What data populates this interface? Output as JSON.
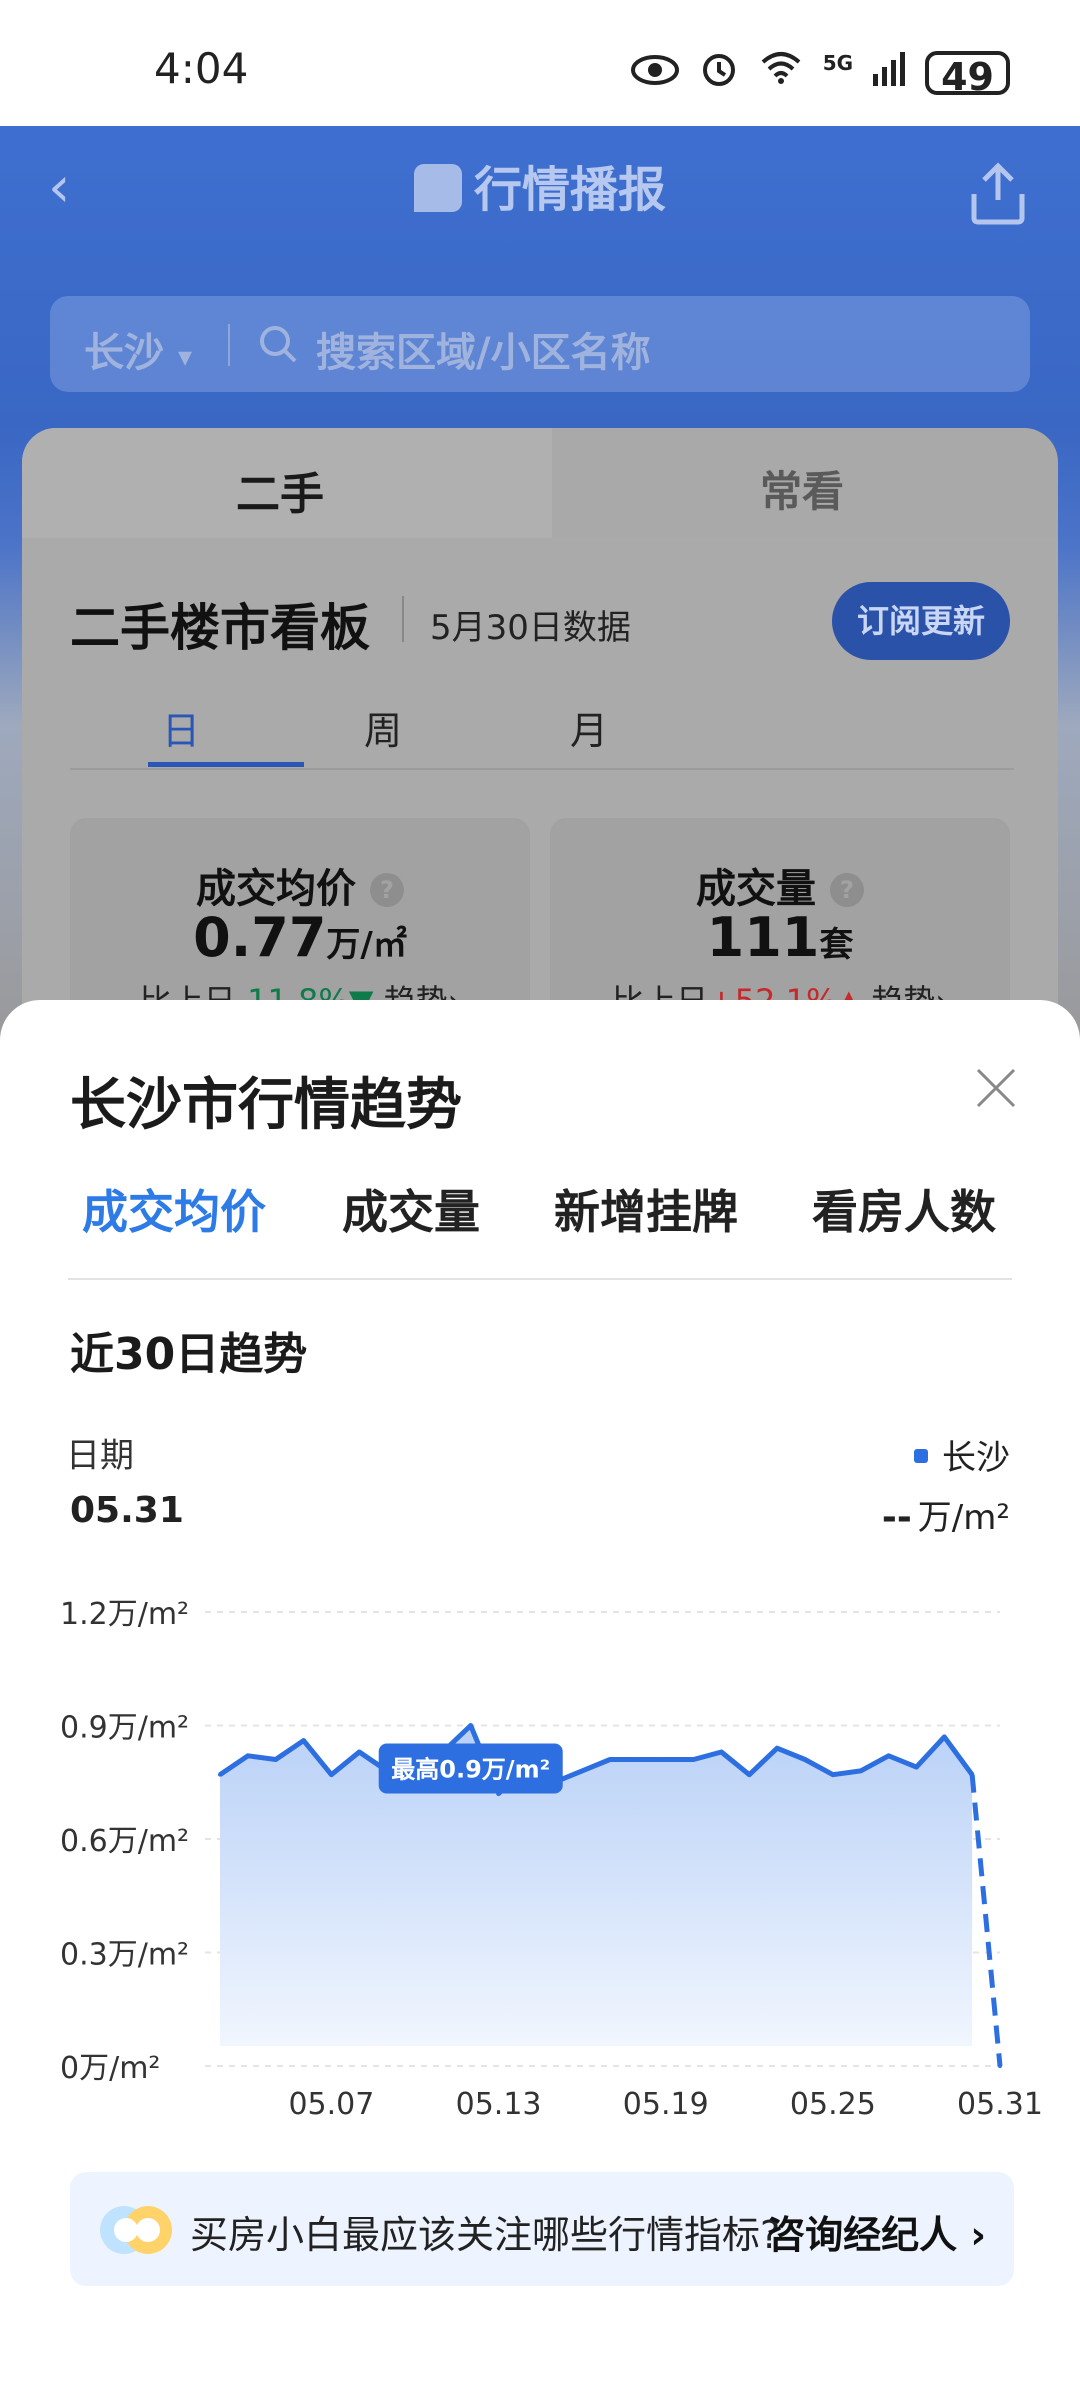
{
  "status_bar": {
    "time": "4:04",
    "icons": [
      "eye-icon",
      "alarm-icon",
      "wifi-icon",
      "signal-5g-icon"
    ],
    "network_label": "5G",
    "battery": "49"
  },
  "header": {
    "title": "行情播报"
  },
  "search": {
    "city": "长沙",
    "placeholder": "搜索区域/小区名称"
  },
  "market_tabs": [
    "二手",
    "常看"
  ],
  "board": {
    "title": "二手楼市看板",
    "date_note": "5月30日数据",
    "subscribe_label": "订阅更新",
    "periods": [
      "日",
      "周",
      "月"
    ],
    "active_period": "日",
    "stats": [
      {
        "label": "成交均价",
        "value": "0.77",
        "unit": "万/㎡",
        "compare_prefix": "比上日",
        "change": "-11.8%",
        "trend_label": "趋势"
      },
      {
        "label": "成交量",
        "value": "111",
        "unit": "套",
        "compare_prefix": "比上日",
        "change": "+52.1%",
        "trend_label": "趋势"
      }
    ]
  },
  "sheet": {
    "title": "长沙市行情趋势",
    "tabs": [
      "成交均价",
      "成交量",
      "新增挂牌",
      "看房人数"
    ],
    "active_tab": "成交均价",
    "section_title": "近30日趋势",
    "date_label": "日期",
    "date_value": "05.31",
    "legend_name": "长沙",
    "legend_value": "--",
    "legend_unit": "万/m²"
  },
  "chart_data": {
    "type": "line",
    "series": [
      {
        "name": "长沙",
        "values": [
          0.77,
          0.82,
          0.81,
          0.86,
          0.77,
          0.83,
          0.78,
          0.8,
          0.83,
          0.9,
          0.72,
          0.79,
          0.75,
          0.78,
          0.81,
          0.81,
          0.81,
          0.81,
          0.83,
          0.77,
          0.84,
          0.81,
          0.77,
          0.78,
          0.82,
          0.79,
          0.87,
          0.77,
          0
        ]
      }
    ],
    "x_ticks": [
      "05.07",
      "05.13",
      "05.19",
      "05.25",
      "05.31"
    ],
    "y_ticks": [
      "1.2万/m²",
      "0.9万/m²",
      "0.6万/m²",
      "0.3万/m²",
      "0万/m²"
    ],
    "ylim": [
      0,
      1.2
    ],
    "annotation": "最高0.9万/m²",
    "line_color": "#2d6fe0",
    "grid": true,
    "last_segment_dashed": true
  },
  "tip": {
    "text": "买房小白最应该关注哪些行情指标?",
    "link_label": "咨询经纪人"
  }
}
